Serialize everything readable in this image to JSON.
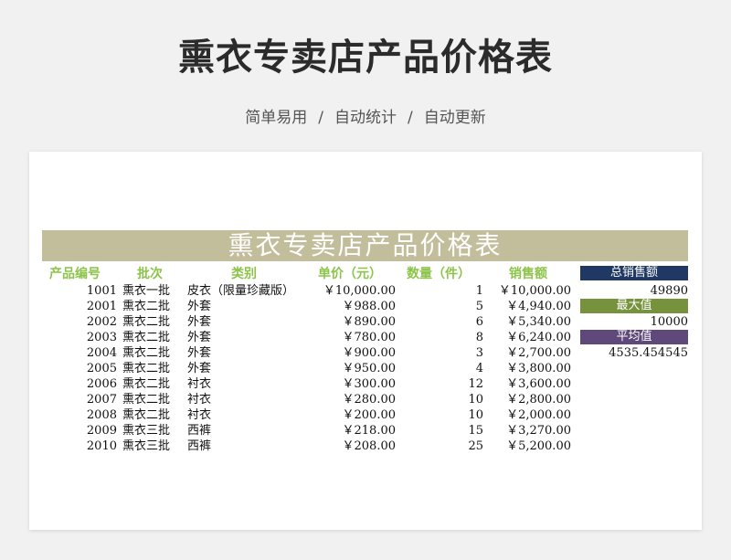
{
  "banner": {
    "title": "熏衣专卖店产品价格表",
    "tag1": "简单易用",
    "tag2": "自动统计",
    "tag3": "自动更新",
    "separator": "/"
  },
  "sheet": {
    "title": "熏衣专卖店产品价格表",
    "title_bg": "#c2bd9a",
    "header_color": "#8cc44a",
    "columns": [
      "产品编号",
      "批次",
      "类别",
      "单价（元）",
      "数量（件）",
      "销售额"
    ],
    "rows": [
      {
        "code": "1001",
        "batch": "熏衣一批",
        "type": "皮衣（限量珍藏版）",
        "price": "￥10,000.00",
        "qty": "1",
        "total": "￥10,000.00"
      },
      {
        "code": "2001",
        "batch": "熏衣二批",
        "type": "外套",
        "price": "￥988.00",
        "qty": "5",
        "total": "￥4,940.00"
      },
      {
        "code": "2002",
        "batch": "熏衣二批",
        "type": "外套",
        "price": "￥890.00",
        "qty": "6",
        "total": "￥5,340.00"
      },
      {
        "code": "2003",
        "batch": "熏衣二批",
        "type": "外套",
        "price": "￥780.00",
        "qty": "8",
        "total": "￥6,240.00"
      },
      {
        "code": "2004",
        "batch": "熏衣二批",
        "type": "外套",
        "price": "￥900.00",
        "qty": "3",
        "total": "￥2,700.00"
      },
      {
        "code": "2005",
        "batch": "熏衣二批",
        "type": "外套",
        "price": "￥950.00",
        "qty": "4",
        "total": "￥3,800.00"
      },
      {
        "code": "2006",
        "batch": "熏衣二批",
        "type": "衬衣",
        "price": "￥300.00",
        "qty": "12",
        "total": "￥3,600.00"
      },
      {
        "code": "2007",
        "batch": "熏衣二批",
        "type": "衬衣",
        "price": "￥280.00",
        "qty": "10",
        "total": "￥2,800.00"
      },
      {
        "code": "2008",
        "batch": "熏衣二批",
        "type": "衬衣",
        "price": "￥200.00",
        "qty": "10",
        "total": "￥2,000.00"
      },
      {
        "code": "2009",
        "batch": "熏衣三批",
        "type": "西裤",
        "price": "￥218.00",
        "qty": "15",
        "total": "￥3,270.00"
      },
      {
        "code": "2010",
        "batch": "熏衣三批",
        "type": "西裤",
        "price": "￥208.00",
        "qty": "25",
        "total": "￥5,200.00"
      }
    ]
  },
  "stats": {
    "total_label": "总销售额",
    "total_value": "49890",
    "total_color": "#1f3864",
    "max_label": "最大值",
    "max_value": "10000",
    "max_color": "#76923c",
    "avg_label": "平均值",
    "avg_value": "4535.454545",
    "avg_color": "#5f497a"
  }
}
